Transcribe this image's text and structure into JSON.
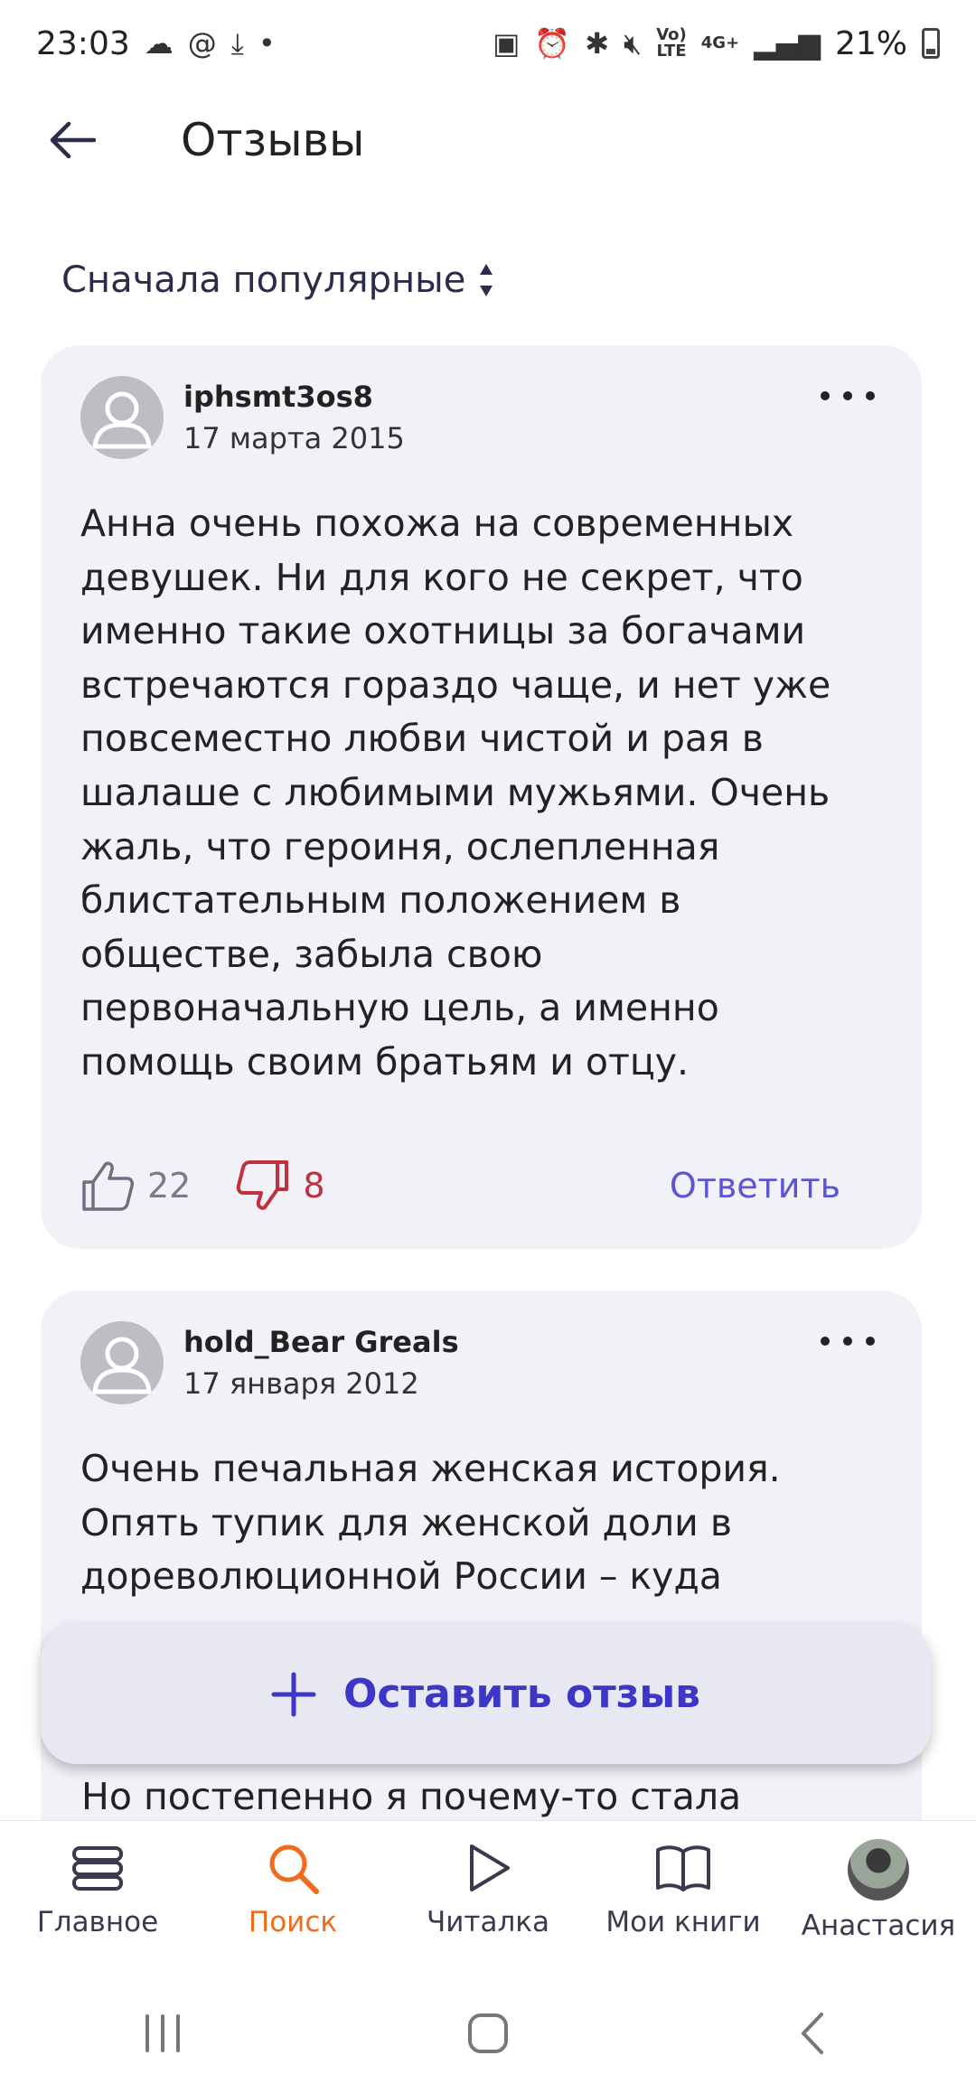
{
  "status_bar": {
    "time": "23:03",
    "at_symbol": "@",
    "dot": "•",
    "volte": "Vo)\nLTE",
    "network": "4G+",
    "battery_percent": "21%"
  },
  "header": {
    "title": "Отзывы"
  },
  "sort": {
    "label": "Сначала популярные"
  },
  "reviews": [
    {
      "author": "iphsmt3os8",
      "date": "17 марта 2015",
      "text": "Анна очень похожа на современных девушек. Ни для кого не секрет, что именно такие охотницы за богачами встречаются гораздо чаще, и нет уже повсеместно любви чистой и рая в шалаше с любимыми мужьями. Очень жаль, что героиня, ослепленная блистательным положением в обществе, забыла свою первоначальную цель, а именно помощь своим братьям и отцу.",
      "likes": "22",
      "dislikes": "8",
      "reply_label": "Ответить"
    },
    {
      "author": "hold_Bear Greals",
      "date": "17 января 2012",
      "text": "Очень печальная женская история. Опять тупик для женской доли в дореволюционной России – куда",
      "tail_text": "Но постепенно я почему-то стала"
    }
  ],
  "leave_review": {
    "label": "Оставить отзыв"
  },
  "bottom_nav": [
    {
      "label": "Главное",
      "icon": "stack-icon"
    },
    {
      "label": "Поиск",
      "icon": "search-icon",
      "active": true
    },
    {
      "label": "Читалка",
      "icon": "play-icon"
    },
    {
      "label": "Мои книги",
      "icon": "book-icon"
    },
    {
      "label": "Анастасия",
      "icon": "profile-avatar"
    }
  ],
  "colors": {
    "accent": "#f26a1c",
    "link": "#5b55d6",
    "primary_button_text": "#3d37c8",
    "dislike": "#c0303e",
    "card_bg": "#f1f1f7"
  }
}
